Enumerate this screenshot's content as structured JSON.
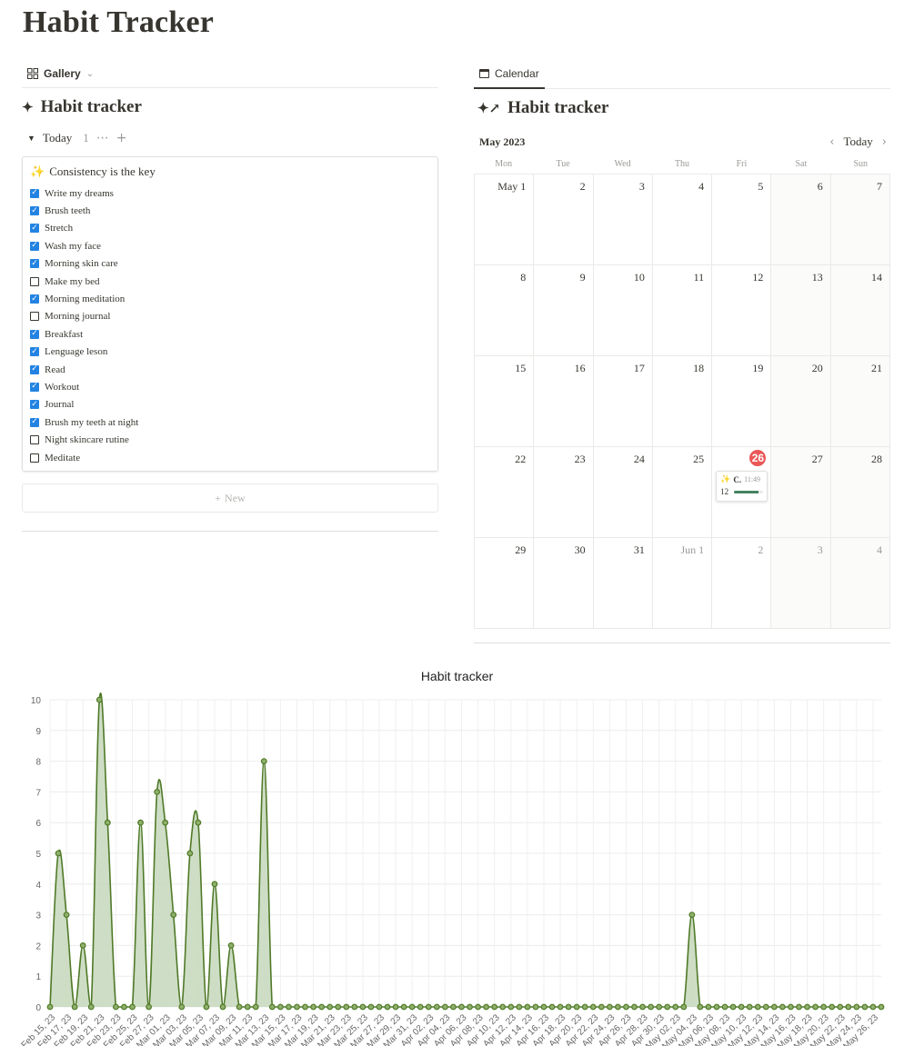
{
  "page": {
    "title": "Habit Tracker"
  },
  "gallery": {
    "view_tab_label": "Gallery",
    "title": "Habit tracker",
    "group": {
      "label": "Today",
      "count": "1"
    },
    "card": {
      "emoji": "✨",
      "title": "Consistency is the key",
      "habits": [
        {
          "label": "Write my dreams",
          "checked": true
        },
        {
          "label": "Brush teeth",
          "checked": true
        },
        {
          "label": "Stretch",
          "checked": true
        },
        {
          "label": "Wash my face",
          "checked": true
        },
        {
          "label": "Morning skin care",
          "checked": true
        },
        {
          "label": "Make my bed",
          "checked": false
        },
        {
          "label": "Morning meditation",
          "checked": true
        },
        {
          "label": "Morning journal",
          "checked": false
        },
        {
          "label": "Breakfast",
          "checked": true
        },
        {
          "label": "Lenguage leson",
          "checked": true
        },
        {
          "label": "Read",
          "checked": true
        },
        {
          "label": "Workout",
          "checked": true
        },
        {
          "label": "Journal",
          "checked": true
        },
        {
          "label": "Brush my teeth at night",
          "checked": true
        },
        {
          "label": "Night skincare rutine",
          "checked": false
        },
        {
          "label": "Meditate",
          "checked": false
        }
      ]
    },
    "new_label": "New"
  },
  "calendar": {
    "view_tab_label": "Calendar",
    "title": "Habit tracker",
    "month": "May 2023",
    "today_label": "Today",
    "weekdays": [
      "Mon",
      "Tue",
      "Wed",
      "Thu",
      "Fri",
      "Sat",
      "Sun"
    ],
    "days": [
      "May 1",
      "2",
      "3",
      "4",
      "5",
      "6",
      "7",
      "8",
      "9",
      "10",
      "11",
      "12",
      "13",
      "14",
      "15",
      "16",
      "17",
      "18",
      "19",
      "20",
      "21",
      "22",
      "23",
      "24",
      "25",
      "26",
      "27",
      "28",
      "29",
      "30",
      "31",
      "Jun 1",
      "2",
      "3",
      "4"
    ],
    "today_index": 25,
    "event": {
      "day_index": 25,
      "title": "C.",
      "time": "11:49",
      "value": "12",
      "progress": 0.85
    },
    "colors": {
      "today_badge": "#eb5757",
      "progress": "#448361"
    }
  },
  "chart_data": {
    "type": "area",
    "title": "Habit tracker",
    "ylim": [
      0,
      10
    ],
    "yticks": [
      "0",
      "1",
      "2",
      "3",
      "4",
      "5",
      "6",
      "7",
      "8",
      "9",
      "10"
    ],
    "grid": true,
    "colors": {
      "line": "#4f7a28",
      "fill": "#c9d9bf"
    },
    "x": [
      "Feb 15, 23",
      "Feb 16, 23",
      "Feb 17, 23",
      "Feb 18, 23",
      "Feb 19, 23",
      "Feb 20, 23",
      "Feb 21, 23",
      "Feb 22, 23",
      "Feb 23, 23",
      "Feb 24, 23",
      "Feb 25, 23",
      "Feb 26, 23",
      "Feb 27, 23",
      "Feb 28, 23",
      "Mar 01, 23",
      "Mar 02, 23",
      "Mar 03, 23",
      "Mar 04, 23",
      "Mar 05, 23",
      "Mar 06, 23",
      "Mar 07, 23",
      "Mar 08, 23",
      "Mar 09, 23",
      "Mar 10, 23",
      "Mar 11, 23",
      "Mar 12, 23",
      "Mar 13, 23",
      "Mar 14, 23",
      "Mar 15, 23",
      "Mar 16, 23",
      "Mar 17, 23",
      "Mar 18, 23",
      "Mar 19, 23",
      "Mar 20, 23",
      "Mar 21, 23",
      "Mar 22, 23",
      "Mar 23, 23",
      "Mar 24, 23",
      "Mar 25, 23",
      "Mar 26, 23",
      "Mar 27, 23",
      "Mar 28, 23",
      "Mar 29, 23",
      "Mar 30, 23",
      "Mar 31, 23",
      "Apr 01, 23",
      "Apr 02, 23",
      "Apr 03, 23",
      "Apr 04, 23",
      "Apr 05, 23",
      "Apr 06, 23",
      "Apr 07, 23",
      "Apr 08, 23",
      "Apr 09, 23",
      "Apr 10, 23",
      "Apr 11, 23",
      "Apr 12, 23",
      "Apr 13, 23",
      "Apr 14, 23",
      "Apr 15, 23",
      "Apr 16, 23",
      "Apr 17, 23",
      "Apr 18, 23",
      "Apr 19, 23",
      "Apr 20, 23",
      "Apr 21, 23",
      "Apr 22, 23",
      "Apr 23, 23",
      "Apr 24, 23",
      "Apr 25, 23",
      "Apr 26, 23",
      "Apr 27, 23",
      "Apr 28, 23",
      "Apr 29, 23",
      "Apr 30, 23",
      "May 01, 23",
      "May 02, 23",
      "May 03, 23",
      "May 04, 23",
      "May 05, 23",
      "May 06, 23",
      "May 07, 23",
      "May 08, 23",
      "May 09, 23",
      "May 10, 23",
      "May 11, 23",
      "May 12, 23",
      "May 13, 23",
      "May 14, 23",
      "May 15, 23",
      "May 16, 23",
      "May 17, 23",
      "May 18, 23",
      "May 19, 23",
      "May 20, 23",
      "May 21, 23",
      "May 22, 23",
      "May 23, 23",
      "May 24, 23",
      "May 25, 23",
      "May 26, 23"
    ],
    "values": [
      0,
      5,
      3,
      0,
      2,
      0,
      10,
      6,
      0,
      0,
      0,
      6,
      0,
      7,
      6,
      3,
      0,
      5,
      6,
      0,
      4,
      0,
      2,
      0,
      0,
      0,
      8,
      0,
      0,
      0,
      0,
      0,
      0,
      0,
      0,
      0,
      0,
      0,
      0,
      0,
      0,
      0,
      0,
      0,
      0,
      0,
      0,
      0,
      0,
      0,
      0,
      0,
      0,
      0,
      0,
      0,
      0,
      0,
      0,
      0,
      0,
      0,
      0,
      0,
      0,
      0,
      0,
      0,
      0,
      0,
      0,
      0,
      0,
      0,
      0,
      0,
      0,
      0,
      3,
      0,
      0,
      0,
      0,
      0,
      0,
      0,
      0,
      0,
      0,
      0,
      0,
      0,
      0,
      0,
      0,
      0,
      0,
      0,
      0,
      0,
      0,
      0
    ],
    "label_every": 2
  }
}
